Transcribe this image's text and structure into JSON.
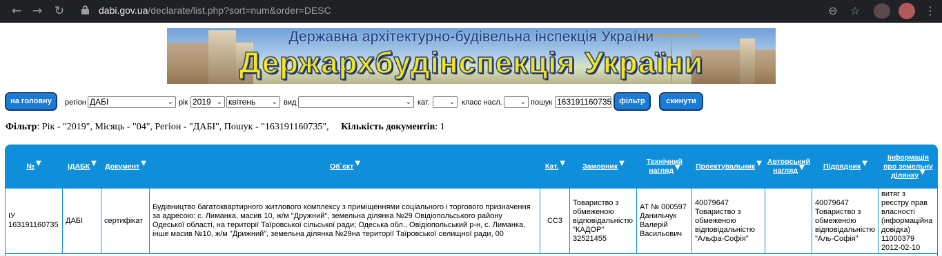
{
  "browser": {
    "url_host": "dabi.gov.ua",
    "url_path": "/declarate/list.php?sort=num&order=DESC"
  },
  "banner": {
    "subtitle": "Державна архітектурно-будівельна інспекція України",
    "title": "Держархбудінспекція України"
  },
  "filters": {
    "home_button": "на головну",
    "region_label": "регіон",
    "region_value": "ДАБІ",
    "year_label": "рік",
    "year_value": "2019",
    "month_value": "квітень",
    "type_label": "вид",
    "type_value": "",
    "cat_label": "кат.",
    "cat_value": "",
    "class_label": "класс насл.",
    "class_value": "",
    "search_label": "пошук",
    "search_value": "163191160735",
    "filter_button": "фільтр",
    "reset_button": "скинути"
  },
  "summary": {
    "filter_label": "Фільтр",
    "filter_text": ": Рік - \"2019\", Місяць - \"04\", Регіон - \"ДАБІ\", Пошук - \"163191160735\",",
    "count_label": "Кількість документів",
    "count_value": ": 1"
  },
  "table": {
    "headers": {
      "num": "№",
      "idabk": "ІДАБК",
      "document": "Документ",
      "object": "Об`єкт",
      "cat": "Кат.",
      "customer": "Замовник",
      "tech_line1": "Технічний",
      "tech_line2": "нагляд",
      "designer": "Проектувальник",
      "author_line1": "Авторський",
      "author_line2": "нагляд",
      "contractor": "Підрядник",
      "land_line1": "Інформація",
      "land_line2": "про земельну",
      "land_line3": "ділянку"
    },
    "row": {
      "num_line1": "ІУ",
      "num_line2": "163191160735",
      "idabk": "ДАБІ",
      "document": "сертифікат",
      "object": "Будівництво багатоквартирного житлового комплексу з приміщеннями соціального і торгового призначення за адресою: с. Лиманка, масив 10, ж/м \"Дружний\", земельна ділянка №29 Овідіопольського району Одеської області, на території Таїровської сільської ради; Одеська обл., Овідіопольський р-н, с. Лиманка, інше масив №10, ж/м \"Дрижний\", земельна ділянка №29на території Таїровської селищної ради, 00",
      "cat": "СС3",
      "customer": "Товариство з обмеженою відповідальністю \"КАДОР\" 32521455",
      "tech": "АТ № 000597 Данильчук Валерій Васильович",
      "designer": "40079647 Товариство з обмеженою відповідальністю \"Альфа-Софія\"",
      "author": "",
      "contractor": "40079647 Товариство з обмеженою відповідальністю \"Аль-Софія\"",
      "land": "витяг з реєстру прав власності (інформаційна довідка) 11000379 2012-02-10"
    }
  }
}
